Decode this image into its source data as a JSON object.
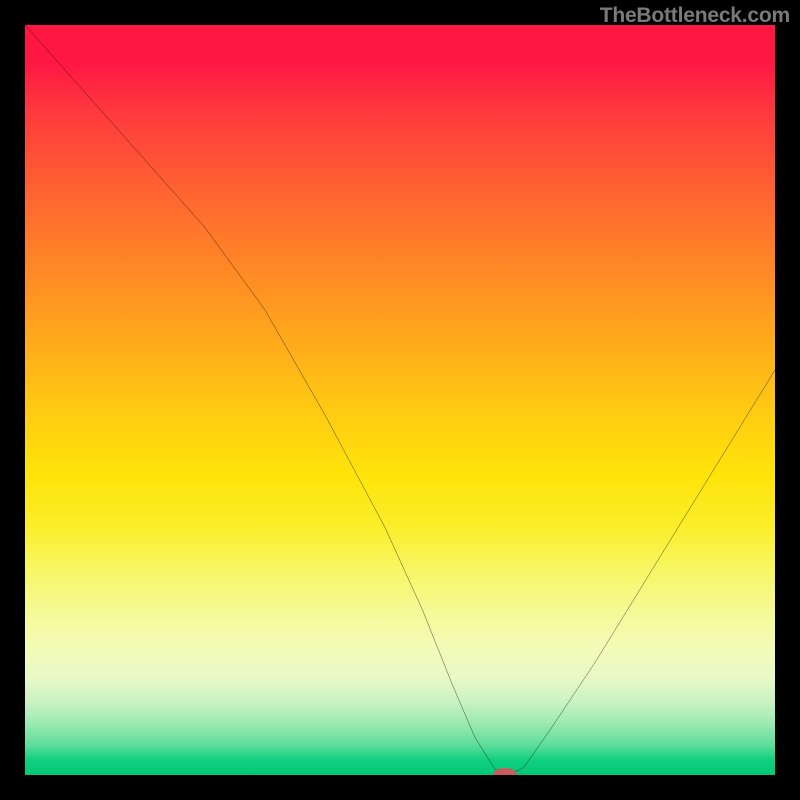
{
  "watermark": "TheBottleneck.com",
  "chart_data": {
    "type": "line",
    "title": "",
    "xlabel": "",
    "ylabel": "",
    "xlim": [
      0,
      100
    ],
    "ylim": [
      0,
      100
    ],
    "series": [
      {
        "name": "bottleneck-curve",
        "x": [
          0,
          8,
          16,
          24,
          32,
          40,
          48,
          53,
          57,
          60,
          62.5,
          63.5,
          64.5,
          66.5,
          70,
          76,
          84,
          92,
          100
        ],
        "y": [
          100,
          91,
          82,
          73,
          62,
          48,
          33,
          22,
          12,
          5,
          1,
          0,
          0,
          1,
          6,
          15,
          28,
          41,
          54
        ]
      }
    ],
    "marker": {
      "x": 64,
      "y": 0,
      "color": "#c95c5c",
      "rx": 12,
      "ry": 7
    }
  },
  "colors": {
    "gradient_top": "#ff1744",
    "gradient_mid": "#ffe40a",
    "gradient_bottom": "#00c776",
    "frame": "#000000",
    "curve": "#000000",
    "marker": "#c95c5c"
  }
}
